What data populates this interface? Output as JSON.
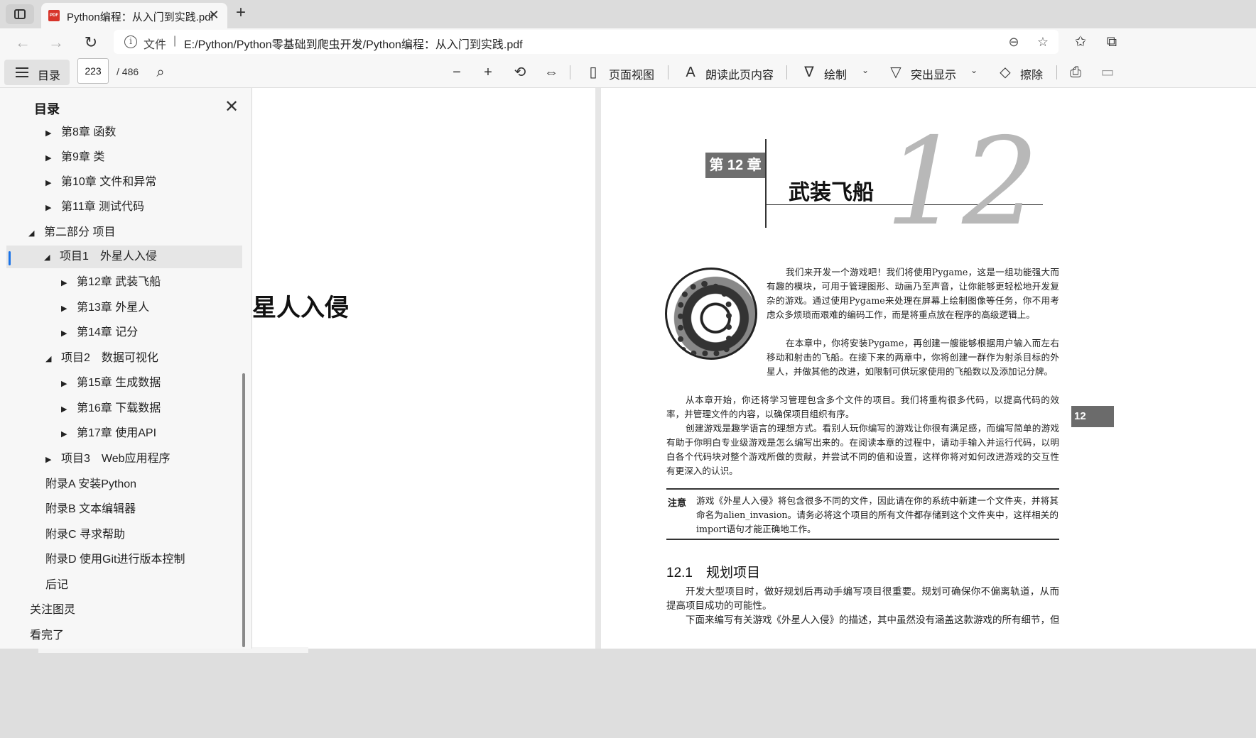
{
  "browser": {
    "tab_title": "Python编程：从入门到实践.pdf",
    "tab_icon_text": "PDF",
    "close_glyph": "✕",
    "new_tab_glyph": "+",
    "site_label": "文件",
    "separator": "|",
    "url": "E:/Python/Python零基础到爬虫开发/Python编程：从入门到实践.pdf"
  },
  "pdf_toolbar": {
    "toc_label": "目录",
    "current_page": "223",
    "total_pages": "/ 486",
    "page_view_label": "页面视图",
    "read_aloud_label": "朗读此页内容",
    "draw_label": "绘制",
    "highlight_label": "突出显示",
    "erase_label": "擦除"
  },
  "sidebar": {
    "title": "目录",
    "items": [
      {
        "label": "第8章 函数",
        "arrow": "▶"
      },
      {
        "label": "第9章 类",
        "arrow": "▶"
      },
      {
        "label": "第10章 文件和异常",
        "arrow": "▶"
      },
      {
        "label": "第11章 测试代码",
        "arrow": "▶"
      },
      {
        "label": "第二部分 项目",
        "arrow": "◢"
      },
      {
        "label": "项目1　外星人入侵",
        "arrow": "◢"
      },
      {
        "label": "第12章 武装飞船",
        "arrow": "▶"
      },
      {
        "label": "第13章 外星人",
        "arrow": "▶"
      },
      {
        "label": "第14章 记分",
        "arrow": "▶"
      },
      {
        "label": "项目2　数据可视化",
        "arrow": "◢"
      },
      {
        "label": "第15章 生成数据",
        "arrow": "▶"
      },
      {
        "label": "第16章 下载数据",
        "arrow": "▶"
      },
      {
        "label": "第17章 使用API",
        "arrow": "▶"
      },
      {
        "label": "项目3　Web应用程序",
        "arrow": "▶"
      },
      {
        "label": "附录A 安装Python",
        "arrow": ""
      },
      {
        "label": "附录B 文本编辑器",
        "arrow": ""
      },
      {
        "label": "附录C 寻求帮助",
        "arrow": ""
      },
      {
        "label": "附录D 使用Git进行版本控制",
        "arrow": ""
      },
      {
        "label": "后记",
        "arrow": ""
      },
      {
        "label": "关注图灵",
        "arrow": ""
      },
      {
        "label": "看完了",
        "arrow": ""
      }
    ]
  },
  "left_page": {
    "heading": "星人入侵"
  },
  "right_page": {
    "chapter_badge": "第 12 章",
    "chapter_title": "武装飞船",
    "chapter_number": "12",
    "side_tab": "12",
    "para1": "我们来开发一个游戏吧！我们将使用Pygame，这是一组功能强大而有趣的模块，可用于管理图形、动画乃至声音，让你能够更轻松地开发复杂的游戏。通过使用Pygame来处理在屏幕上绘制图像等任务，你不用考虑众多烦琐而艰难的编码工作，而是将重点放在程序的高级逻辑上。",
    "para2": "在本章中，你将安装Pygame，再创建一艘能够根据用户输入而左右移动和射击的飞船。在接下来的两章中，你将创建一群作为射杀目标的外星人，并做其他的改进，如限制可供玩家使用的飞船数以及添加记分牌。",
    "para3": "从本章开始，你还将学习管理包含多个文件的项目。我们将重构很多代码，以提高代码的效率，并管理文件的内容，以确保项目组织有序。",
    "para4": "创建游戏是趣学语言的理想方式。看别人玩你编写的游戏让你很有满足感，而编写简单的游戏有助于你明白专业级游戏是怎么编写出来的。在阅读本章的过程中，请动手输入并运行代码，以明白各个代码块对整个游戏所做的贡献，并尝试不同的值和设置，这样你将对如何改进游戏的交互性有更深入的认识。",
    "note_label": "注意",
    "note_text": "游戏《外星人入侵》将包含很多不同的文件，因此请在你的系统中新建一个文件夹，并将其命名为alien_invasion。请务必将这个项目的所有文件都存储到这个文件夹中，这样相关的import语句才能正确地工作。",
    "section_title": "12.1　规划项目",
    "para5": "开发大型项目时，做好规划后再动手编写项目很重要。规划可确保你不偏离轨道，从而提高项目成功的可能性。",
    "para6": "下面来编写有关游戏《外星人入侵》的描述，其中虽然没有涵盖这款游戏的所有细节，但能"
  },
  "icons": {
    "back": "back-arrow-icon",
    "forward": "forward-arrow-icon",
    "reload": "reload-icon",
    "info": "info-icon"
  }
}
